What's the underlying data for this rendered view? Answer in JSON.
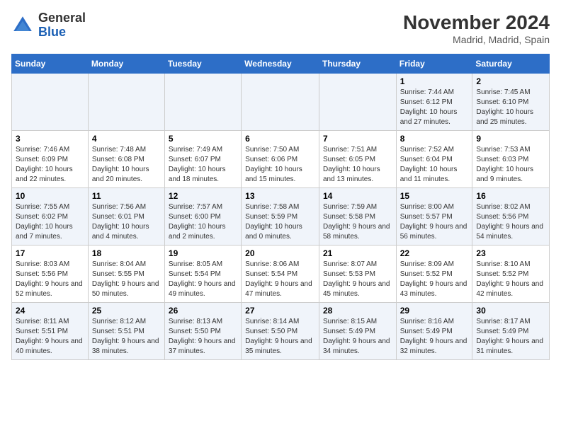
{
  "logo": {
    "general": "General",
    "blue": "Blue"
  },
  "title": {
    "month_year": "November 2024",
    "location": "Madrid, Madrid, Spain"
  },
  "days_of_week": [
    "Sunday",
    "Monday",
    "Tuesday",
    "Wednesday",
    "Thursday",
    "Friday",
    "Saturday"
  ],
  "weeks": [
    [
      {
        "day": "",
        "info": ""
      },
      {
        "day": "",
        "info": ""
      },
      {
        "day": "",
        "info": ""
      },
      {
        "day": "",
        "info": ""
      },
      {
        "day": "",
        "info": ""
      },
      {
        "day": "1",
        "info": "Sunrise: 7:44 AM\nSunset: 6:12 PM\nDaylight: 10 hours and 27 minutes."
      },
      {
        "day": "2",
        "info": "Sunrise: 7:45 AM\nSunset: 6:10 PM\nDaylight: 10 hours and 25 minutes."
      }
    ],
    [
      {
        "day": "3",
        "info": "Sunrise: 7:46 AM\nSunset: 6:09 PM\nDaylight: 10 hours and 22 minutes."
      },
      {
        "day": "4",
        "info": "Sunrise: 7:48 AM\nSunset: 6:08 PM\nDaylight: 10 hours and 20 minutes."
      },
      {
        "day": "5",
        "info": "Sunrise: 7:49 AM\nSunset: 6:07 PM\nDaylight: 10 hours and 18 minutes."
      },
      {
        "day": "6",
        "info": "Sunrise: 7:50 AM\nSunset: 6:06 PM\nDaylight: 10 hours and 15 minutes."
      },
      {
        "day": "7",
        "info": "Sunrise: 7:51 AM\nSunset: 6:05 PM\nDaylight: 10 hours and 13 minutes."
      },
      {
        "day": "8",
        "info": "Sunrise: 7:52 AM\nSunset: 6:04 PM\nDaylight: 10 hours and 11 minutes."
      },
      {
        "day": "9",
        "info": "Sunrise: 7:53 AM\nSunset: 6:03 PM\nDaylight: 10 hours and 9 minutes."
      }
    ],
    [
      {
        "day": "10",
        "info": "Sunrise: 7:55 AM\nSunset: 6:02 PM\nDaylight: 10 hours and 7 minutes."
      },
      {
        "day": "11",
        "info": "Sunrise: 7:56 AM\nSunset: 6:01 PM\nDaylight: 10 hours and 4 minutes."
      },
      {
        "day": "12",
        "info": "Sunrise: 7:57 AM\nSunset: 6:00 PM\nDaylight: 10 hours and 2 minutes."
      },
      {
        "day": "13",
        "info": "Sunrise: 7:58 AM\nSunset: 5:59 PM\nDaylight: 10 hours and 0 minutes."
      },
      {
        "day": "14",
        "info": "Sunrise: 7:59 AM\nSunset: 5:58 PM\nDaylight: 9 hours and 58 minutes."
      },
      {
        "day": "15",
        "info": "Sunrise: 8:00 AM\nSunset: 5:57 PM\nDaylight: 9 hours and 56 minutes."
      },
      {
        "day": "16",
        "info": "Sunrise: 8:02 AM\nSunset: 5:56 PM\nDaylight: 9 hours and 54 minutes."
      }
    ],
    [
      {
        "day": "17",
        "info": "Sunrise: 8:03 AM\nSunset: 5:56 PM\nDaylight: 9 hours and 52 minutes."
      },
      {
        "day": "18",
        "info": "Sunrise: 8:04 AM\nSunset: 5:55 PM\nDaylight: 9 hours and 50 minutes."
      },
      {
        "day": "19",
        "info": "Sunrise: 8:05 AM\nSunset: 5:54 PM\nDaylight: 9 hours and 49 minutes."
      },
      {
        "day": "20",
        "info": "Sunrise: 8:06 AM\nSunset: 5:54 PM\nDaylight: 9 hours and 47 minutes."
      },
      {
        "day": "21",
        "info": "Sunrise: 8:07 AM\nSunset: 5:53 PM\nDaylight: 9 hours and 45 minutes."
      },
      {
        "day": "22",
        "info": "Sunrise: 8:09 AM\nSunset: 5:52 PM\nDaylight: 9 hours and 43 minutes."
      },
      {
        "day": "23",
        "info": "Sunrise: 8:10 AM\nSunset: 5:52 PM\nDaylight: 9 hours and 42 minutes."
      }
    ],
    [
      {
        "day": "24",
        "info": "Sunrise: 8:11 AM\nSunset: 5:51 PM\nDaylight: 9 hours and 40 minutes."
      },
      {
        "day": "25",
        "info": "Sunrise: 8:12 AM\nSunset: 5:51 PM\nDaylight: 9 hours and 38 minutes."
      },
      {
        "day": "26",
        "info": "Sunrise: 8:13 AM\nSunset: 5:50 PM\nDaylight: 9 hours and 37 minutes."
      },
      {
        "day": "27",
        "info": "Sunrise: 8:14 AM\nSunset: 5:50 PM\nDaylight: 9 hours and 35 minutes."
      },
      {
        "day": "28",
        "info": "Sunrise: 8:15 AM\nSunset: 5:49 PM\nDaylight: 9 hours and 34 minutes."
      },
      {
        "day": "29",
        "info": "Sunrise: 8:16 AM\nSunset: 5:49 PM\nDaylight: 9 hours and 32 minutes."
      },
      {
        "day": "30",
        "info": "Sunrise: 8:17 AM\nSunset: 5:49 PM\nDaylight: 9 hours and 31 minutes."
      }
    ]
  ]
}
